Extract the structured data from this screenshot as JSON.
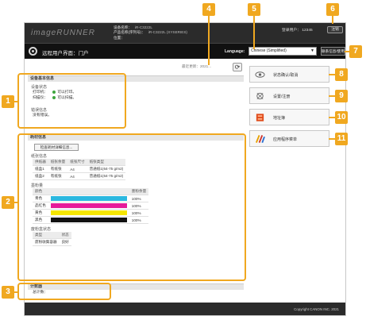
{
  "header": {
    "brand": "imageRUNNER",
    "device_name_label": "设备名称：",
    "device_name_value": "iR-C3222L",
    "product_label": "产品名称(序列号)：",
    "product_value": "iR-C3222L (XYSERIES)",
    "location_label": "位置：",
    "login_user": "登录用户：  12345",
    "logout_label": "注销"
  },
  "titlebar": {
    "title": "远程用户界面：门户",
    "language_label": "Language:",
    "language_value": "Chinese (Simplified)",
    "portal_button": "联系信息/使用说明书"
  },
  "last_updated": "最近更新：2021...",
  "device_basic": {
    "heading": "设备基本信息",
    "status_title": "设备状态",
    "printer_label": "打印机：",
    "printer_status": "可以打印。",
    "scanner_label": "扫描仪：",
    "scanner_status": "可以扫描。",
    "error_title": "错误信息",
    "error_text": "没有错误。"
  },
  "consumables": {
    "heading": "耗材信息",
    "check_button": "检查耗材详细信息...",
    "paper_title": "纸张信息",
    "paper_headers": [
      "供纸器",
      "纸张余量",
      "纸张尺寸",
      "纸张类型"
    ],
    "paper_rows": [
      [
        "纸盒1",
        "有纸张",
        "A4",
        "普通纸1(64-75 g/m2)"
      ],
      [
        "纸盒2",
        "有纸张",
        "A4",
        "普通纸1(64-75 g/m2)"
      ]
    ],
    "toner_title": "墨粉量",
    "toner_headers": [
      "颜色",
      "",
      "墨粉余量"
    ],
    "toners": [
      {
        "name": "青色",
        "color": "#2bb8e0",
        "level": "100%"
      },
      {
        "name": "品红色",
        "color": "#e6199a",
        "level": "100%"
      },
      {
        "name": "黄色",
        "color": "#f5e600",
        "level": "100%"
      },
      {
        "name": "黑色",
        "color": "#111111",
        "level": "100%"
      }
    ],
    "waste_title": "废粉盒状态",
    "waste_headers": [
      "类型",
      "状态"
    ],
    "waste_row": [
      "废粉收集容器",
      "良好"
    ]
  },
  "counter": {
    "heading": "计数器",
    "text": "总计数："
  },
  "right_buttons": [
    {
      "label": "状态确认/取消",
      "icon": "eye-icon"
    },
    {
      "label": "设置/注册",
      "icon": "settings-gear-icon"
    },
    {
      "label": "地址簿",
      "icon": "address-book-icon"
    },
    {
      "label": "应用程序菜单",
      "icon": "application-menu-icon"
    }
  ],
  "footer": {
    "copyright": "Copyright CANON INC. 2021"
  },
  "callouts": [
    "1",
    "2",
    "3",
    "4",
    "5",
    "6",
    "7",
    "8",
    "9",
    "10",
    "11"
  ],
  "accent_color": "#f0a820"
}
